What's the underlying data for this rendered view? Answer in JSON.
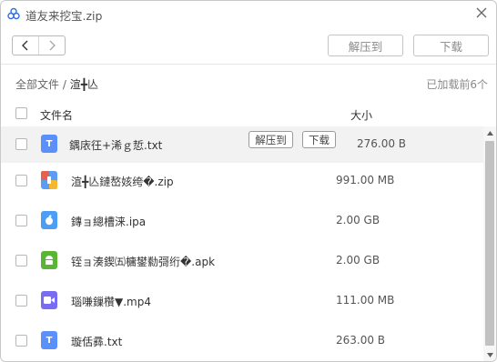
{
  "window": {
    "title": "道友来挖宝.zip",
    "app_icon": "cloud-icon",
    "close_icon": "close-icon"
  },
  "toolbar": {
    "back_icon": "chevron-left-icon",
    "forward_icon": "chevron-right-icon",
    "extract_label": "解压到",
    "download_label": "下载"
  },
  "path": {
    "root": "全部文件",
    "separator": "/",
    "current": "渲╋亾",
    "loaded_text": "已加载前6个"
  },
  "columns": {
    "name": "文件名",
    "size": "大小"
  },
  "row_actions": {
    "extract_label": "解压到",
    "download_label": "下载"
  },
  "files": [
    {
      "name": "鍝庡彺+浠ｇ悊.txt",
      "size": "276.00 B",
      "icon": "txt-file-icon",
      "glyph": "T",
      "color": "#5b8ff9"
    },
    {
      "name": "渲╋亾鏈嶅姟绔�.zip",
      "size": "991.00 MB",
      "icon": "zip-file-icon",
      "glyph": "",
      "color": "#e8604c"
    },
    {
      "name": "鏄ョ總槽涞.ipa",
      "size": "2.00 GB",
      "icon": "apple-file-icon",
      "glyph": "",
      "color": "#4a9ff5"
    },
    {
      "name": "铚ョ湊鍥㈤槦鐢勬彁绗�.apk",
      "size": "2.00 GB",
      "icon": "android-file-icon",
      "glyph": "",
      "color": "#5bb534"
    },
    {
      "name": "瑙嗛鏁欑▼.mp4",
      "size": "111.00 MB",
      "icon": "video-file-icon",
      "glyph": "",
      "color": "#7a6cf0"
    },
    {
      "name": "璇佸彞.txt",
      "size": "263.00 B",
      "icon": "txt-file-icon",
      "glyph": "T",
      "color": "#5b8ff9"
    }
  ],
  "scrollbar": {
    "up_icon": "arrow-up-icon",
    "down_icon": "arrow-down-icon"
  }
}
